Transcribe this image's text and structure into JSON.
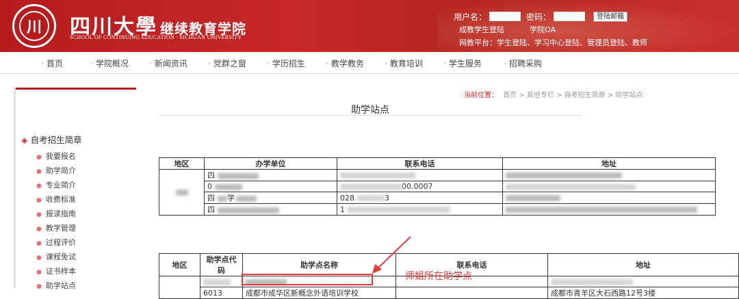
{
  "header": {
    "logo_cn": "四川大學",
    "logo_sub": "继续教育学院",
    "logo_en": "SCHOOL OF CONTINUING EDUCATION · SICHUAN UNIVERSITY",
    "seal_glyph": "川",
    "username_label": "用户名：",
    "password_label": "密码：",
    "login_button": "登陆邮箱",
    "line2_a": "成教学生登陆",
    "line2_b": "学院OA",
    "line3": "网教平台：学生登陆、学习中心登陆、管理员登陆、教师"
  },
  "nav": [
    "首页",
    "学院概况",
    "新闻资讯",
    "党群之窗",
    "学历招生",
    "教学教务",
    "教育培训",
    "学生服务",
    "招聘采购"
  ],
  "sidebar": {
    "title": "自考招生简章",
    "items": [
      "我要报名",
      "助学简介",
      "专业简介",
      "收费标准",
      "报读指南",
      "教学管理",
      "过程评价",
      "课程免试",
      "证书样本",
      "助学站点"
    ]
  },
  "breadcrumb": {
    "label": "当前位置：",
    "path": "首页 > 其他专栏 > 自考招生简章 > 助学站点"
  },
  "page_title": "助学站点",
  "table1": {
    "headers": [
      "地区",
      "办学单位",
      "联系电话",
      "地址"
    ],
    "rows": [
      {
        "unit_prefix": "四",
        "phone_prefix": "",
        "phone_suffix": ""
      },
      {
        "unit_prefix": "0",
        "phone_prefix": "",
        "phone_suffix": "00.0007"
      },
      {
        "unit_prefix": "四",
        "unit_mid": "学",
        "phone_prefix": "028",
        "phone_suffix": "3"
      },
      {
        "unit_prefix": "四",
        "unit_mid": "",
        "phone_prefix": "1",
        "phone_suffix": ""
      }
    ]
  },
  "table2": {
    "headers": [
      "地区",
      "助学点代码",
      "助学点名称",
      "联系电话",
      "地址"
    ],
    "row": {
      "code": "6013",
      "name": "成都市成华区新概念外语培训学校",
      "address": "成都市青羊区大石西路12号3楼"
    }
  },
  "annotation": "师姐所在助学点",
  "colors": {
    "brand_red": "#b71c1c",
    "annotation_red": "#e53935"
  }
}
